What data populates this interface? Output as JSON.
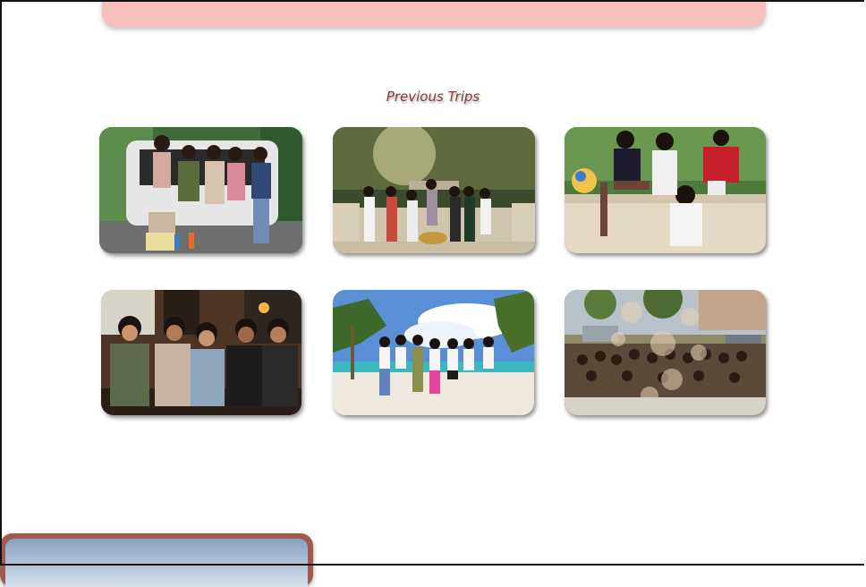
{
  "section": {
    "title": "Previous Trips"
  },
  "photos": [
    {
      "icon": "group-photo-car-trunk"
    },
    {
      "icon": "group-photo-fountain"
    },
    {
      "icon": "group-photo-stone-wall"
    },
    {
      "icon": "group-photo-restaurant-bench"
    },
    {
      "icon": "group-photo-beach"
    },
    {
      "icon": "group-photo-street-bokeh"
    }
  ],
  "colors": {
    "banner": "#f8c0bb",
    "title": "#8b3a33",
    "card_border": "#a05a50"
  }
}
